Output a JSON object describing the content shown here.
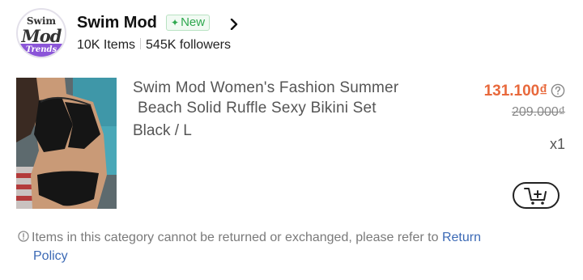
{
  "store": {
    "logo": {
      "line1": "Swim",
      "line2": "Mod",
      "band": "Trends"
    },
    "name": "Swim Mod",
    "badge": {
      "icon": "sparkle-icon",
      "label": "New",
      "color": "#2fa84f"
    },
    "items_count": "10K Items",
    "followers": "545K followers"
  },
  "product": {
    "image_alt": "black-ruffle-bikini-photo",
    "title_line1": "Swim Mod Women's Fashion Summer",
    "title_line2": "Beach Solid Ruffle Sexy Bikini Set",
    "variant": "Black / L",
    "price_current": "131.100₫",
    "price_original": "209.000₫",
    "quantity": "x1",
    "price_color": "#e8693c"
  },
  "notice": {
    "text": "Items in this category cannot be returned or exchanged, please refer to",
    "link_word1": "Return",
    "link_word2": "Policy",
    "link_color": "#3b69b5"
  },
  "icons": {
    "chevron": "chevron-right-icon",
    "help": "question-circle-icon",
    "cart": "add-to-cart-icon",
    "info": "info-circle-icon"
  }
}
